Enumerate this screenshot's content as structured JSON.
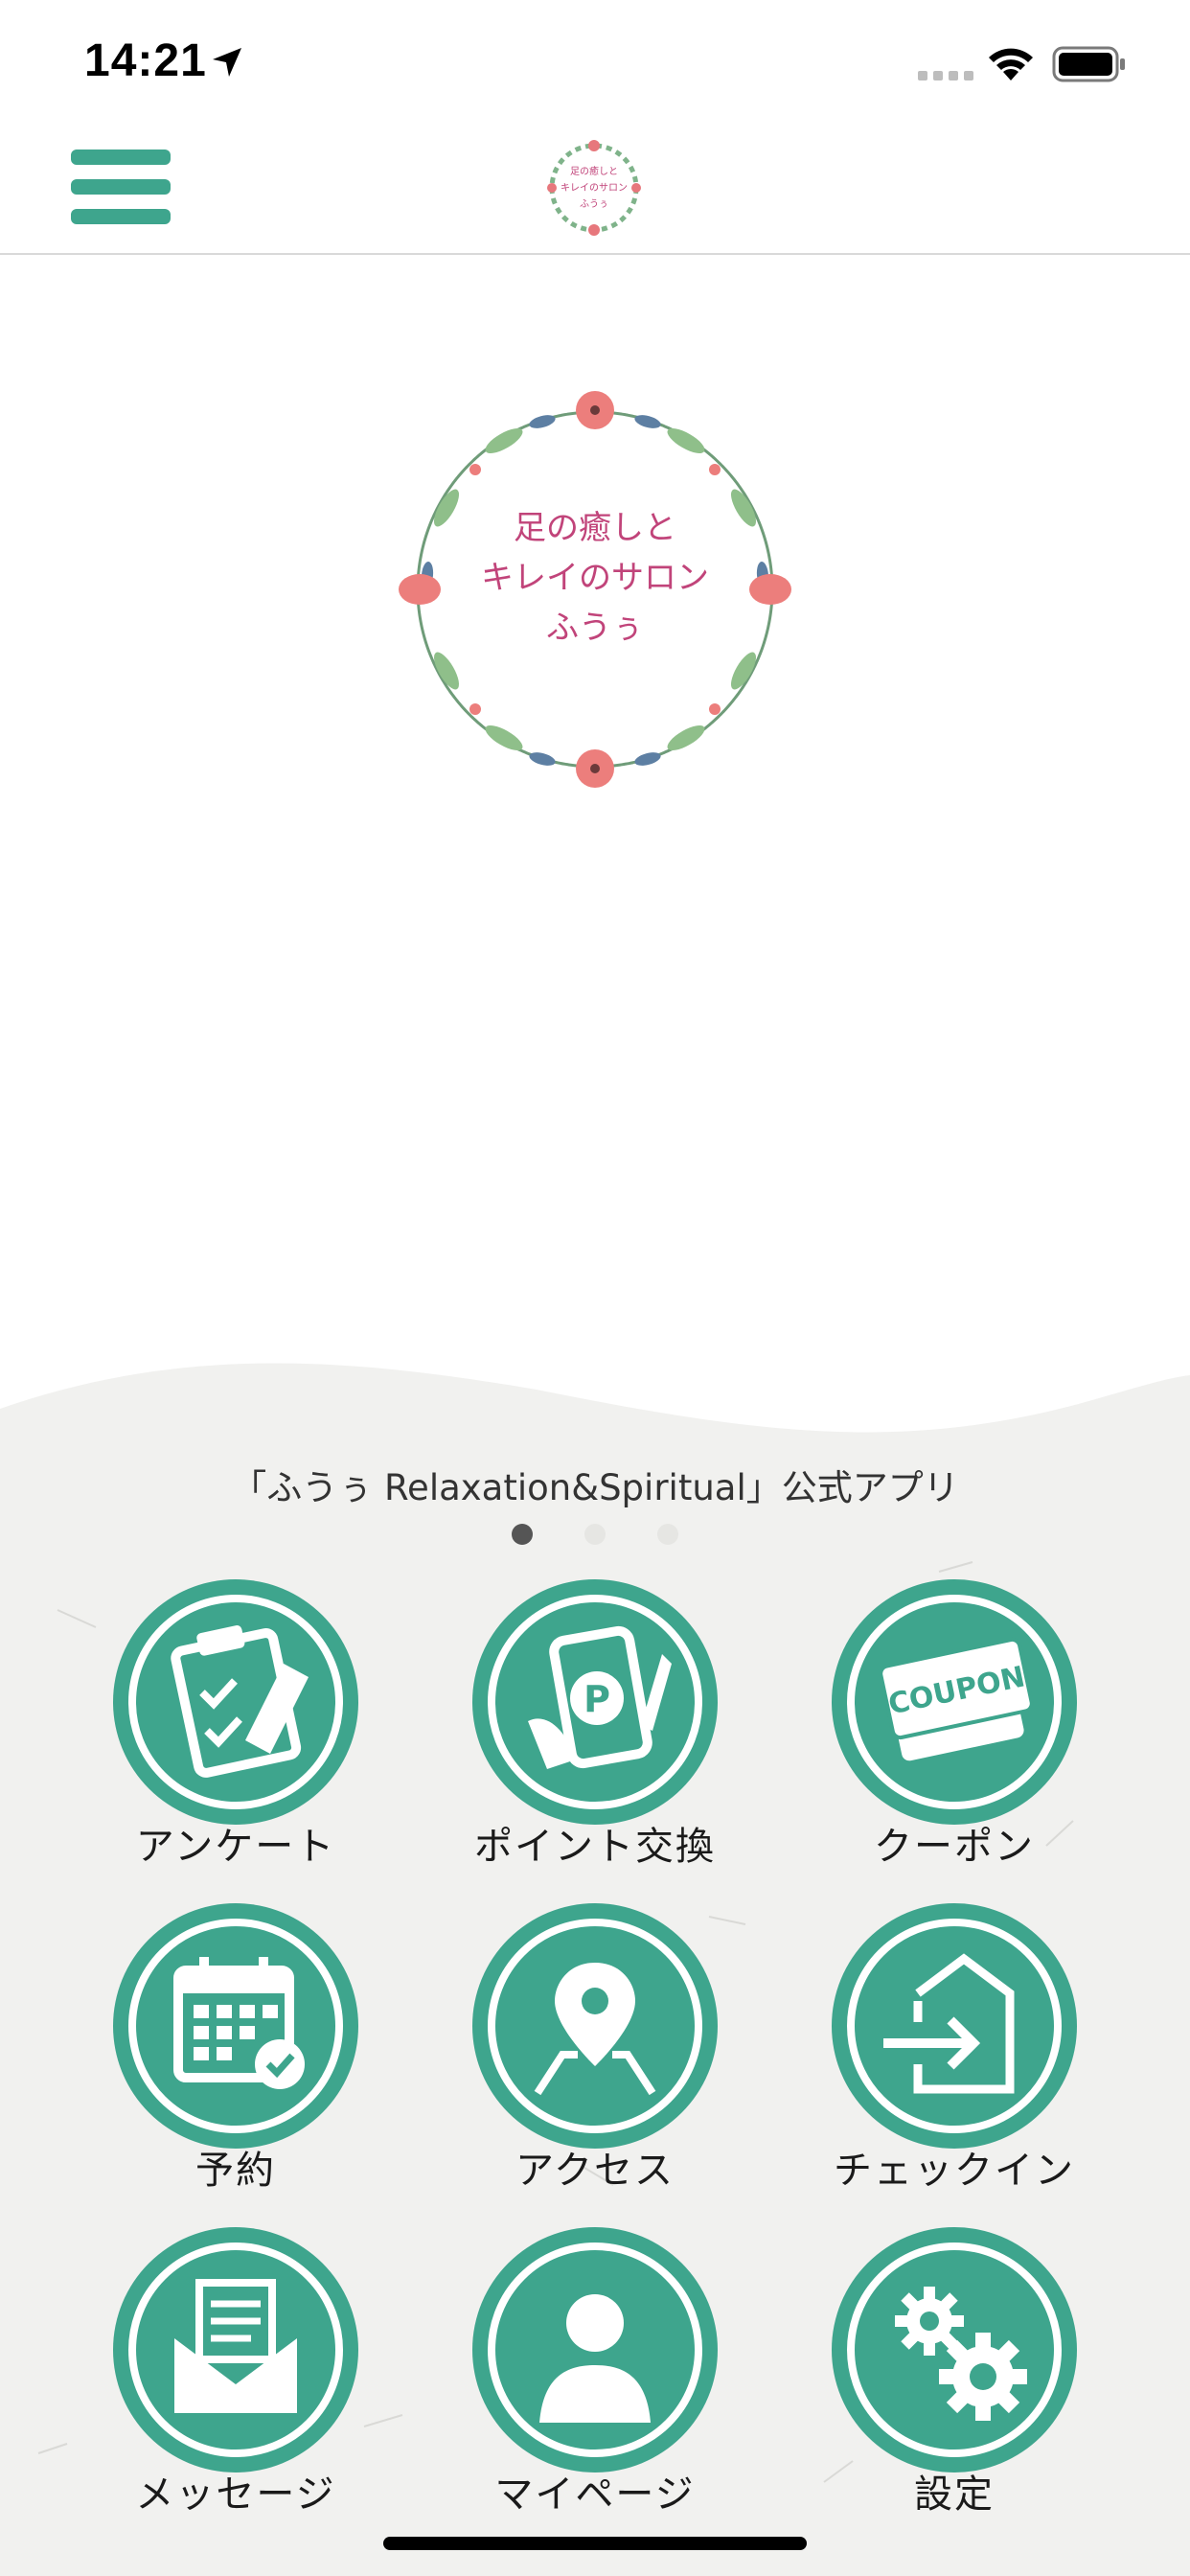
{
  "status_bar": {
    "time": "14:21"
  },
  "header": {
    "menu_icon": "hamburger-icon",
    "logo_alt": "足の癒しとキレイのサロン ふうぅ"
  },
  "hero": {
    "logo_lines": [
      "足の癒しと",
      "キレイのサロン",
      "ふうぅ"
    ],
    "logo_text_color": "#c1447a"
  },
  "tagline": "「ふうぅ Relaxation&Spiritual」公式アプリ",
  "pager": {
    "count": 3,
    "active_index": 0
  },
  "menu": [
    {
      "label": "アンケート",
      "icon": "survey-clipboard-icon"
    },
    {
      "label": "ポイント交換",
      "icon": "point-exchange-icon"
    },
    {
      "label": "クーポン",
      "icon": "coupon-icon",
      "icon_text": "COUPON"
    },
    {
      "label": "予約",
      "icon": "calendar-check-icon"
    },
    {
      "label": "アクセス",
      "icon": "map-pin-icon"
    },
    {
      "label": "チェックイン",
      "icon": "check-in-icon"
    },
    {
      "label": "メッセージ",
      "icon": "message-envelope-icon"
    },
    {
      "label": "マイページ",
      "icon": "user-profile-icon"
    },
    {
      "label": "設定",
      "icon": "settings-gears-icon"
    }
  ],
  "colors": {
    "accent": "#3ea58d",
    "accent_dark": "#2f8f79",
    "background_texture": "#f1f1ef"
  }
}
